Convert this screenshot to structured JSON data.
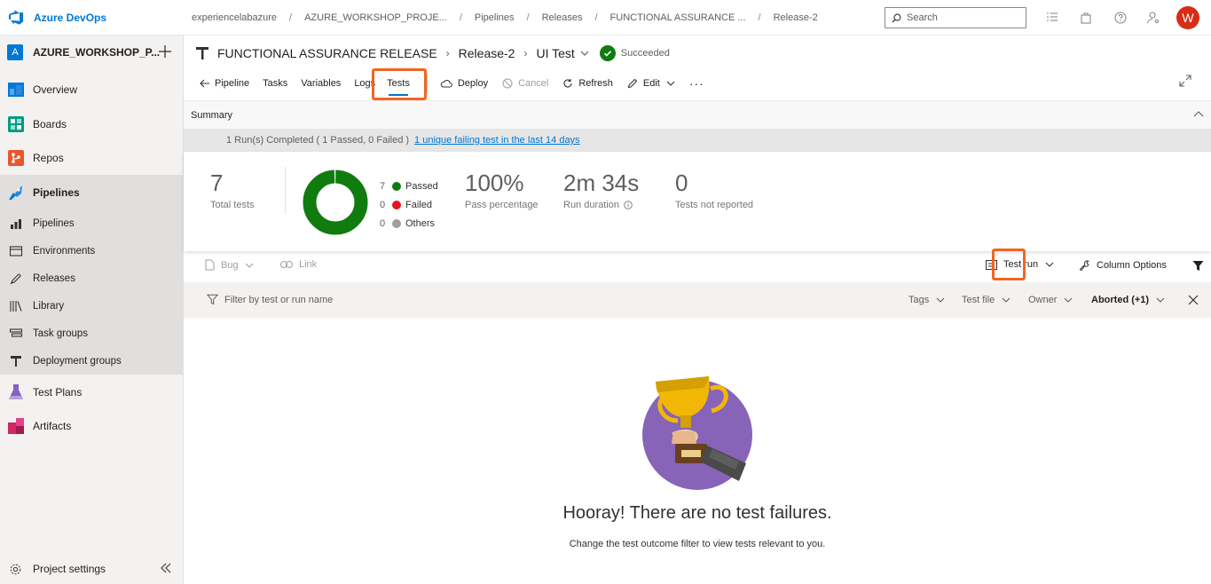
{
  "app": {
    "name": "Azure DevOps",
    "colors": {
      "accent": "#0078d4",
      "success": "#107c10",
      "failed": "#e81123",
      "others": "#a19f9d",
      "highlight": "#f26522"
    }
  },
  "breadcrumb": [
    "experiencelabazure",
    "AZURE_WORKSHOP_PROJE...",
    "Pipelines",
    "Releases",
    "FUNCTIONAL ASSURANCE ...",
    "Release-2"
  ],
  "search": {
    "placeholder": "Search"
  },
  "user": {
    "initial": "W"
  },
  "sidebar": {
    "project_badge": "A",
    "project_name": "AZURE_WORKSHOP_P...",
    "items": [
      {
        "label": "Overview",
        "icon": "overview-icon"
      },
      {
        "label": "Boards",
        "icon": "boards-icon"
      },
      {
        "label": "Repos",
        "icon": "repos-icon"
      },
      {
        "label": "Pipelines",
        "icon": "pipelines-icon"
      },
      {
        "label": "Test Plans",
        "icon": "test-plans-icon"
      },
      {
        "label": "Artifacts",
        "icon": "artifacts-icon"
      }
    ],
    "sub_items": [
      {
        "label": "Pipelines",
        "icon": "pipelines-sub-icon"
      },
      {
        "label": "Environments",
        "icon": "environments-icon"
      },
      {
        "label": "Releases",
        "icon": "releases-icon"
      },
      {
        "label": "Library",
        "icon": "library-icon"
      },
      {
        "label": "Task groups",
        "icon": "task-groups-icon"
      },
      {
        "label": "Deployment groups",
        "icon": "deployment-groups-icon"
      }
    ],
    "settings_label": "Project settings"
  },
  "header": {
    "release_def": "FUNCTIONAL ASSURANCE RELEASE",
    "release": "Release-2",
    "stage": "UI Test",
    "status": "Succeeded"
  },
  "tabs": {
    "pipeline": "Pipeline",
    "tasks": "Tasks",
    "variables": "Variables",
    "logs": "Logs",
    "tests": "Tests"
  },
  "commands": {
    "deploy": "Deploy",
    "cancel": "Cancel",
    "refresh": "Refresh",
    "edit": "Edit",
    "more": "···"
  },
  "summary": {
    "title": "Summary",
    "run_text": "1 Run(s) Completed ( 1 Passed, 0 Failed )",
    "run_link": "1 unique failing test in the last 14 days",
    "total_tests": "7",
    "total_tests_label": "Total tests",
    "legend": [
      {
        "count": "7",
        "label": "Passed"
      },
      {
        "count": "0",
        "label": "Failed"
      },
      {
        "count": "0",
        "label": "Others"
      }
    ],
    "pass_percentage": "100%",
    "pass_percentage_label": "Pass percentage",
    "run_duration": "2m 34s",
    "run_duration_label": "Run duration",
    "not_reported": "0",
    "not_reported_label": "Tests not reported",
    "donut": {
      "passed": 7,
      "failed": 0,
      "others": 0
    }
  },
  "toolbar": {
    "bug": "Bug",
    "link": "Link",
    "test_run": "Test run",
    "column_options": "Column Options"
  },
  "filters": {
    "placeholder": "Filter by test or run name",
    "tags": "Tags",
    "test_file": "Test file",
    "owner": "Owner",
    "outcome": "Aborted (+1)"
  },
  "empty_state": {
    "title": "Hooray! There are no test failures.",
    "subtitle": "Change the test outcome filter to view tests relevant to you."
  }
}
